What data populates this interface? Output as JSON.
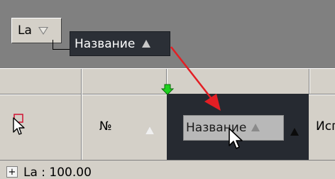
{
  "group_panel": {
    "group_la_label": "La",
    "group_name_label": "Название"
  },
  "grid": {
    "col_number_header": "№",
    "col_name_header": "Название",
    "next_col_header_fragment": "Исп"
  },
  "footer": {
    "expand_label": "+",
    "group_row_text": "La : 100.00"
  },
  "icons": {
    "drop_marker_color": "#1fd11f",
    "drag_arrow_color": "#e31e24"
  }
}
